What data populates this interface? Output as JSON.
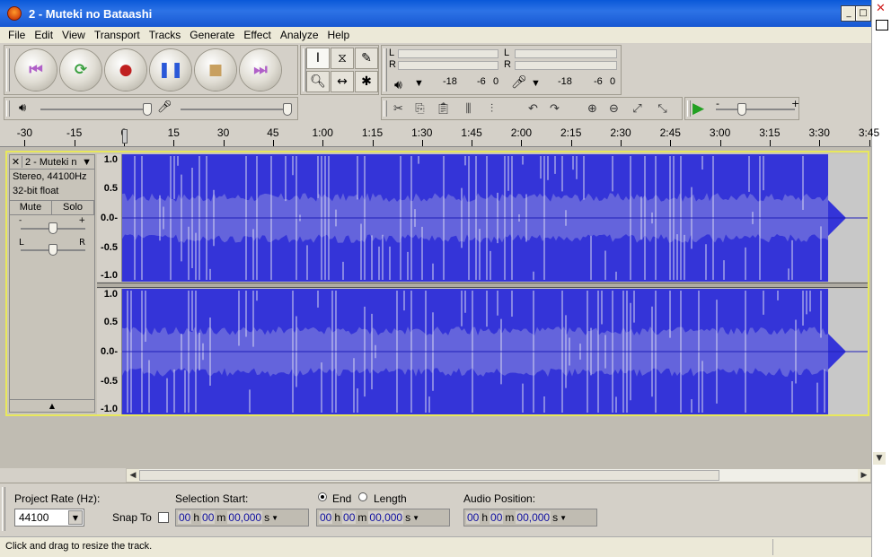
{
  "window": {
    "title": "2 - Muteki no Bataashi",
    "minimize_glyph": "_",
    "maximize_glyph": "□"
  },
  "menu": [
    "File",
    "Edit",
    "View",
    "Transport",
    "Tracks",
    "Generate",
    "Effect",
    "Analyze",
    "Help"
  ],
  "transport": {
    "buttons": [
      {
        "name": "skip-to-start-button",
        "glyph": "⏮",
        "color": "#b060c8"
      },
      {
        "name": "loop-play-button",
        "glyph": "⟳",
        "color": "#3aa040"
      },
      {
        "name": "record-button",
        "glyph": "●",
        "color": "#c02020"
      },
      {
        "name": "pause-button",
        "glyph": "❚❚",
        "color": "#2a58d8"
      },
      {
        "name": "stop-button",
        "glyph": "■",
        "color": "#c8a060"
      },
      {
        "name": "skip-to-end-button",
        "glyph": "⏭",
        "color": "#b060c8"
      }
    ]
  },
  "tools": {
    "row1": [
      {
        "name": "selection-tool",
        "glyph": "I"
      },
      {
        "name": "envelope-tool",
        "glyph": "⧖"
      },
      {
        "name": "draw-tool",
        "glyph": "✎"
      }
    ],
    "row2": [
      {
        "name": "zoom-tool",
        "glyph": "🔍︎"
      },
      {
        "name": "timeshift-tool",
        "glyph": "↔"
      },
      {
        "name": "multi-tool",
        "glyph": "✱"
      }
    ]
  },
  "meters": {
    "play_L": "L",
    "play_R": "R",
    "rec_L": "L",
    "rec_R": "R",
    "play_scale": [
      "-18",
      "-6",
      "0"
    ],
    "rec_scale": [
      "-18",
      "-6",
      "0"
    ]
  },
  "edit_toolbar": [
    {
      "name": "cut-icon",
      "glyph": "✂"
    },
    {
      "name": "copy-icon",
      "glyph": "⎘"
    },
    {
      "name": "paste-icon",
      "glyph": "📋︎"
    },
    {
      "name": "trim-icon",
      "glyph": "⫼"
    },
    {
      "name": "silence-icon",
      "glyph": "⫶"
    },
    {
      "name": "undo-icon",
      "glyph": "↶"
    },
    {
      "name": "redo-icon",
      "glyph": "↷"
    },
    {
      "name": "zoom-in-icon",
      "glyph": "⊕"
    },
    {
      "name": "zoom-out-icon",
      "glyph": "⊖"
    },
    {
      "name": "fit-selection-icon",
      "glyph": "⤢"
    },
    {
      "name": "fit-project-icon",
      "glyph": "⤡"
    }
  ],
  "speed": {
    "minus": "-",
    "plus": "+"
  },
  "ruler": {
    "ticks": [
      "-30",
      "-15",
      "0",
      "15",
      "30",
      "45",
      "1:00",
      "1:15",
      "1:30",
      "1:45",
      "2:00",
      "2:15",
      "2:30",
      "2:45",
      "3:00",
      "3:15",
      "3:30",
      "3:45"
    ]
  },
  "track": {
    "name": "2 - Muteki n",
    "close": "✕",
    "menu_arrow": "▼",
    "info_line1": "Stereo, 44100Hz",
    "info_line2": "32-bit float",
    "mute": "Mute",
    "solo": "Solo",
    "gain_minus": "-",
    "gain_plus": "+",
    "pan_left": "L",
    "pan_right": "R",
    "collapse": "▲",
    "vruler": [
      "1.0",
      "0.5",
      "0.0-",
      "-0.5",
      "-1.0"
    ],
    "wave_color": "#3434d8",
    "rms_color": "#6464dc",
    "clip_color": "#c8c8c8"
  },
  "selection_bar": {
    "project_rate_label": "Project Rate (Hz):",
    "project_rate": "44100",
    "snap_to": "Snap To",
    "selection_start_label": "Selection Start:",
    "end_label": "End",
    "length_label": "Length",
    "audio_position_label": "Audio Position:",
    "start": {
      "h": "00",
      "m": "00",
      "s": "00,000"
    },
    "end": {
      "h": "00",
      "m": "00",
      "s": "00,000"
    },
    "position": {
      "h": "00",
      "m": "00",
      "s": "00,000"
    },
    "h_unit": "h",
    "m_unit": "m",
    "s_unit": "s"
  },
  "status": "Click and drag to resize the track."
}
